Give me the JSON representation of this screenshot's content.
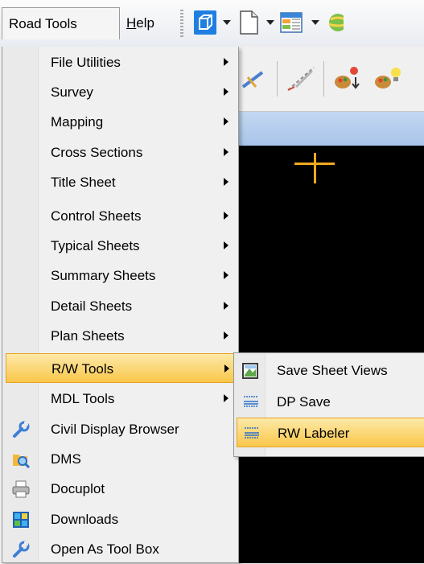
{
  "menubar": {
    "road_tools": "Road Tools",
    "help_letter": "H",
    "help_rest": "elp"
  },
  "toolbar": {
    "icons": [
      "3d-box-icon",
      "new-file-icon",
      "spreadsheet-icon",
      "globe-icon"
    ]
  },
  "toolbar2": {
    "icons": [
      "pointer-tool-icon",
      "measure-tool-icon",
      "palette-arrow-icon",
      "palette-bulb-icon"
    ]
  },
  "menu": {
    "items": [
      {
        "label": "File Utilities",
        "submenu": true,
        "icon": ""
      },
      {
        "label": "Survey",
        "submenu": true,
        "icon": ""
      },
      {
        "label": "Mapping",
        "submenu": true,
        "icon": ""
      },
      {
        "label": "Cross Sections",
        "submenu": true,
        "icon": ""
      },
      {
        "label": "Title Sheet",
        "submenu": true,
        "icon": ""
      },
      {
        "label": "Control Sheets",
        "submenu": true,
        "icon": ""
      },
      {
        "label": "Typical Sheets",
        "submenu": true,
        "icon": ""
      },
      {
        "label": "Summary Sheets",
        "submenu": true,
        "icon": ""
      },
      {
        "label": "Detail Sheets",
        "submenu": true,
        "icon": ""
      },
      {
        "label": "Plan Sheets",
        "submenu": true,
        "icon": ""
      },
      {
        "label": "R/W Tools",
        "submenu": true,
        "icon": "",
        "highlighted": true
      },
      {
        "label": "MDL Tools",
        "submenu": true,
        "icon": ""
      },
      {
        "label": "Civil Display Browser",
        "submenu": false,
        "icon": "wrench-icon"
      },
      {
        "label": "DMS",
        "submenu": false,
        "icon": "dms-search-icon"
      },
      {
        "label": "Docuplot",
        "submenu": false,
        "icon": "printer-icon"
      },
      {
        "label": "Downloads",
        "submenu": false,
        "icon": "downloads-grid-icon"
      },
      {
        "label": "Open As Tool Box",
        "submenu": false,
        "icon": "wrench-icon"
      }
    ]
  },
  "submenu": {
    "items": [
      {
        "label": "Save Sheet Views",
        "icon": "sheet-views-icon"
      },
      {
        "label": "DP Save",
        "icon": "dp-save-icon"
      },
      {
        "label": "RW Labeler",
        "icon": "rw-labeler-icon",
        "highlighted": true
      }
    ]
  },
  "colors": {
    "highlight_top": "#fde9a8",
    "highlight_bottom": "#f9c74a",
    "cursor": "#f0a81e",
    "view_background": "#000000"
  }
}
